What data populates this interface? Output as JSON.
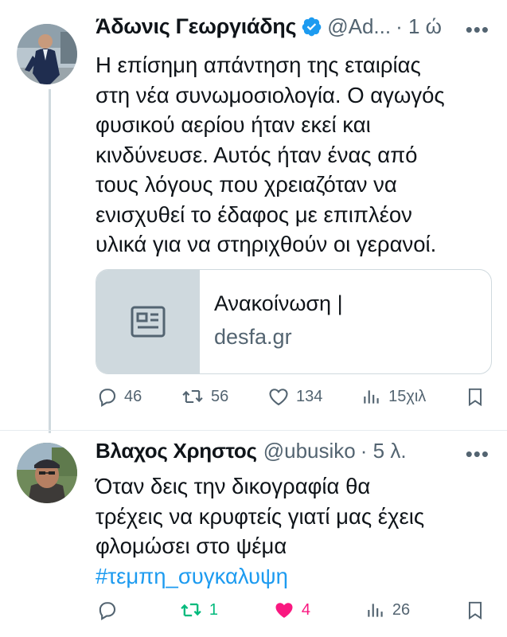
{
  "tweets": [
    {
      "name": "Άδωνις Γεωργιάδης",
      "handle": "@Ad...",
      "time": "· 1 ώ",
      "lines": [
        "Η επίσημη απάντηση της εταιρίας",
        "στη νέα συνωμοσιολογία. Ο αγωγός",
        "φυσικού αερίου ήταν εκεί και",
        "κινδύνευσε. Αυτός ήταν ένας από",
        "τους λόγους που χρειαζόταν να",
        "ενισχυθεί το έδαφος με επιπλέον",
        "υλικά για να στηριχθούν οι γερανοί."
      ],
      "card": {
        "title": "Ανακοίνωση |",
        "domain": "desfa.gr"
      },
      "stats": {
        "replies": "46",
        "retweets": "56",
        "likes": "134",
        "views": "15χιλ"
      }
    },
    {
      "name": "Βλαχος Χρηστος",
      "handle": "@ubusiko",
      "time": "· 5 λ.",
      "lines": [
        "Όταν δεις την δικογραφία θα",
        "τρέχεις να κρυφτείς γιατί μας έχεις",
        "φλομώσει στο ψέμα"
      ],
      "hashtag": "#τεμπη_συγκαλυψη",
      "stats": {
        "replies": "",
        "retweets": "1",
        "likes": "4",
        "views": "26"
      }
    }
  ],
  "more_label": "•••",
  "colors": {
    "accent": "#1d9bf0",
    "retweet_active": "#00ba7c",
    "like_active": "#f91880",
    "muted": "#536471"
  }
}
